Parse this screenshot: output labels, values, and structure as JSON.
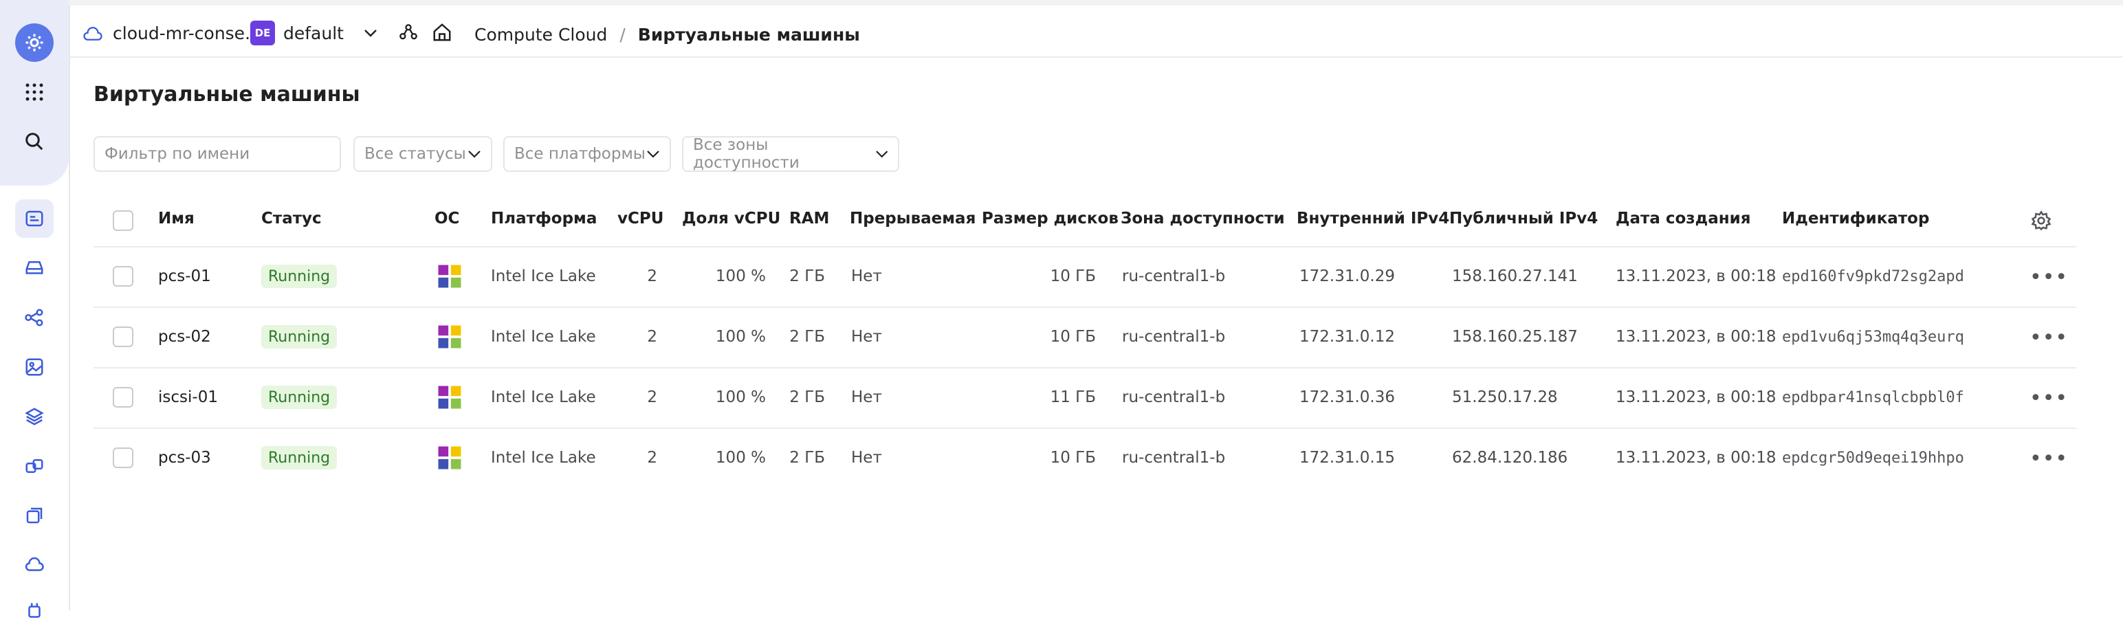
{
  "header": {
    "cloud_name": "cloud-mr-conse...",
    "folder_badge": "DE",
    "folder_name": "default",
    "breadcrumb_service": "Compute Cloud",
    "breadcrumb_separator": "/",
    "breadcrumb_current": "Виртуальные машины"
  },
  "page": {
    "title": "Виртуальные машины"
  },
  "filters": {
    "name_placeholder": "Фильтр по имени",
    "status": "Все статусы",
    "platform": "Все платформы",
    "zone": "Все зоны доступности"
  },
  "table": {
    "columns": {
      "name": "Имя",
      "status": "Статус",
      "os": "ОС",
      "platform": "Платформа",
      "vcpu": "vCPU",
      "vcpu_share": "Доля vCPU",
      "ram": "RAM",
      "preemptible": "Прерываемая",
      "disk_size": "Размер дисков",
      "zone": "Зона доступности",
      "internal_ip": "Внутренний IPv4",
      "public_ip": "Публичный IPv4",
      "created": "Дата создания",
      "id": "Идентификатор"
    },
    "rows": [
      {
        "name": "pcs-01",
        "status": "Running",
        "platform": "Intel Ice Lake",
        "vcpu": "2",
        "vcpu_share": "100 %",
        "ram": "2 ГБ",
        "preemptible": "Нет",
        "disk_size": "10 ГБ",
        "zone": "ru-central1-b",
        "internal_ip": "172.31.0.29",
        "public_ip": "158.160.27.141",
        "created": "13.11.2023, в 00:18",
        "id": "epd160fv9pkd72sg2apd"
      },
      {
        "name": "pcs-02",
        "status": "Running",
        "platform": "Intel Ice Lake",
        "vcpu": "2",
        "vcpu_share": "100 %",
        "ram": "2 ГБ",
        "preemptible": "Нет",
        "disk_size": "10 ГБ",
        "zone": "ru-central1-b",
        "internal_ip": "172.31.0.12",
        "public_ip": "158.160.25.187",
        "created": "13.11.2023, в 00:18",
        "id": "epd1vu6qj53mq4q3eurq"
      },
      {
        "name": "iscsi-01",
        "status": "Running",
        "platform": "Intel Ice Lake",
        "vcpu": "2",
        "vcpu_share": "100 %",
        "ram": "2 ГБ",
        "preemptible": "Нет",
        "disk_size": "11 ГБ",
        "zone": "ru-central1-b",
        "internal_ip": "172.31.0.36",
        "public_ip": "51.250.17.28",
        "created": "13.11.2023, в 00:18",
        "id": "epdbpar41nsqlcbpbl0f"
      },
      {
        "name": "pcs-03",
        "status": "Running",
        "platform": "Intel Ice Lake",
        "vcpu": "2",
        "vcpu_share": "100 %",
        "ram": "2 ГБ",
        "preemptible": "Нет",
        "disk_size": "10 ГБ",
        "zone": "ru-central1-b",
        "internal_ip": "172.31.0.15",
        "public_ip": "62.84.120.186",
        "created": "13.11.2023, в 00:18",
        "id": "epdcgr50d9eqei19hhpo"
      }
    ]
  },
  "icons": {
    "rail": [
      "settings-icon",
      "apps-grid-icon",
      "search-icon",
      "vm-list-icon",
      "disk-icon",
      "network-icon",
      "image-icon",
      "layers-icon",
      "instance-groups-icon",
      "snapshots-icon",
      "cloud-icon",
      "chip-icon"
    ],
    "os": "centos-logo-icon"
  },
  "colors": {
    "accent": "#5b78e8",
    "status_running_bg": "#e6f6df",
    "status_running_text": "#2f7a2a",
    "folder_badge": "#6b3ee0"
  }
}
